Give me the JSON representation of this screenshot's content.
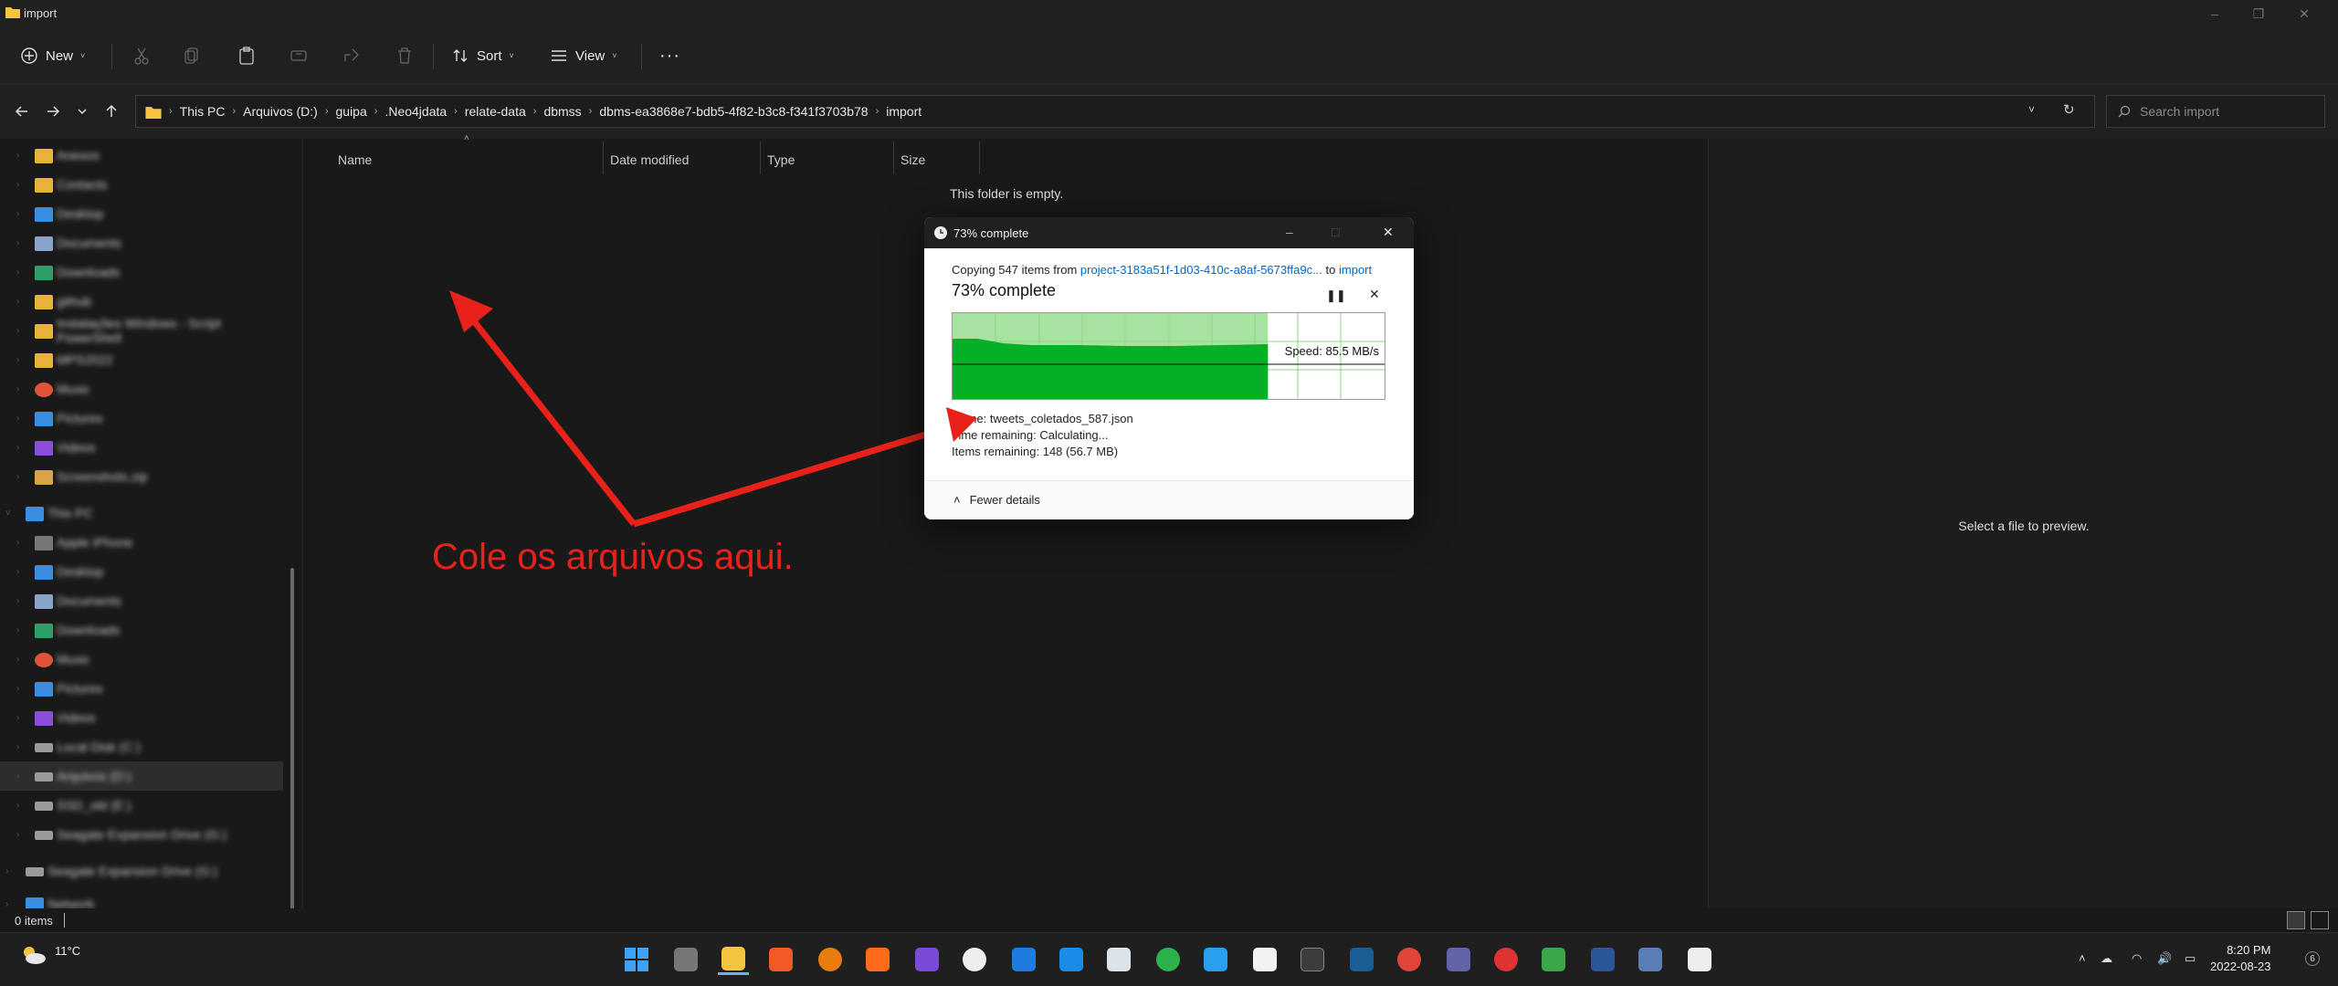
{
  "window": {
    "title": "import"
  },
  "toolbar": {
    "new_label": "New",
    "sort_label": "Sort",
    "view_label": "View",
    "more_label": "···"
  },
  "address": {
    "crumbs": [
      "This PC",
      "Arquivos (D:)",
      "guipa",
      ".Neo4jdata",
      "relate-data",
      "dbmss",
      "dbms-ea3868e7-bdb5-4f82-b3c8-f341f3703b78",
      "import"
    ]
  },
  "search": {
    "placeholder": "Search import"
  },
  "nav_pane": {
    "quick_access": [
      "Anexos",
      "Contacts",
      "Desktop",
      "Documents",
      "Downloads",
      "github",
      "Instalações Windows - Script PowerShell",
      "MPS2022",
      "Music",
      "Pictures",
      "Videos",
      "Screenshots.zip"
    ],
    "this_pc_label": "This PC",
    "this_pc": [
      "Apple iPhone",
      "Desktop",
      "Documents",
      "Downloads",
      "Music",
      "Pictures",
      "Videos",
      "Local Disk (C:)",
      "Arquivos (D:)",
      "SSD_old (E:)",
      "Seagate Expansion Drive (G:)"
    ],
    "extra": "Seagate Expansion Drive (G:)",
    "network": "Network"
  },
  "file_list": {
    "columns": [
      "Name",
      "Date modified",
      "Type",
      "Size"
    ],
    "empty_text": "This folder is empty."
  },
  "preview": {
    "text": "Select a file to preview."
  },
  "status": {
    "items": "0 items"
  },
  "dialog": {
    "title": "73% complete",
    "copy_prefix": "Copying 547 items from ",
    "source": "project-3183a51f-1d03-410c-a8af-5673ffa9c...",
    "to_word": " to ",
    "dest": "import",
    "percent_heading": "73% complete",
    "progress": 0.73,
    "speed": "Speed: 85.5 MB/s",
    "name_label": "Name:",
    "name_value": "tweets_coletados_587.json",
    "time_label": "Time remaining:",
    "time_value": "Calculating...",
    "items_label": "Items remaining:",
    "items_value": "148 (56.7 MB)",
    "fewer_details": "Fewer details"
  },
  "annotation": {
    "text": "Cole os arquivos aqui.",
    "color": "#e8221a"
  },
  "taskbar": {
    "weather": "11°C",
    "time": "8:20 PM",
    "date": "2022-08-23"
  },
  "colors": {
    "accent": "#0066cc",
    "progress_green": "#06b025",
    "progress_light": "#a8e2a0"
  }
}
